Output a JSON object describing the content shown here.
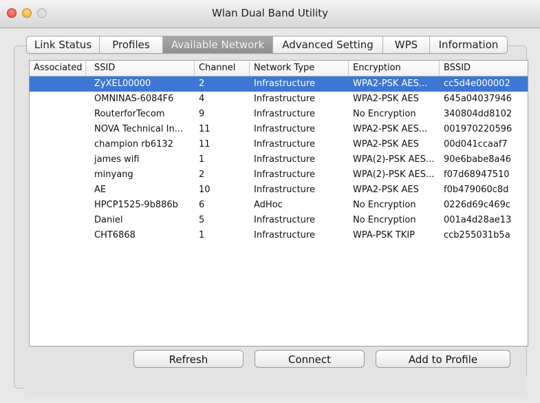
{
  "window": {
    "title": "Wlan Dual Band Utility"
  },
  "tabs": [
    {
      "label": "Link Status",
      "active": false
    },
    {
      "label": "Profiles",
      "active": false
    },
    {
      "label": "Available Network",
      "active": true
    },
    {
      "label": "Advanced Setting",
      "active": false
    },
    {
      "label": "WPS",
      "active": false
    },
    {
      "label": "Information",
      "active": false
    }
  ],
  "table": {
    "columns": [
      "Associated",
      "SSID",
      "Channel",
      "Network Type",
      "Encryption",
      "BSSID"
    ],
    "rows": [
      {
        "associated": "",
        "ssid": "ZyXEL00000",
        "channel": "2",
        "type": "Infrastructure",
        "encryption": "WPA2-PSK AES...",
        "bssid": "cc5d4e000002",
        "selected": true
      },
      {
        "associated": "",
        "ssid": "OMNINAS-6084F6",
        "channel": "4",
        "type": "Infrastructure",
        "encryption": "WPA2-PSK AES",
        "bssid": "645a04037946",
        "selected": false
      },
      {
        "associated": "",
        "ssid": "RouterforTecom",
        "channel": "9",
        "type": "Infrastructure",
        "encryption": "No Encryption",
        "bssid": "340804dd8102",
        "selected": false
      },
      {
        "associated": "",
        "ssid": "NOVA Technical In...",
        "channel": "11",
        "type": "Infrastructure",
        "encryption": "WPA2-PSK AES...",
        "bssid": "001970220596",
        "selected": false
      },
      {
        "associated": "",
        "ssid": "champion rb6132",
        "channel": "11",
        "type": "Infrastructure",
        "encryption": "WPA2-PSK AES",
        "bssid": "00d041ccaaf7",
        "selected": false
      },
      {
        "associated": "",
        "ssid": "james wifi",
        "channel": "1",
        "type": "Infrastructure",
        "encryption": "WPA(2)-PSK AES...",
        "bssid": "90e6babe8a46",
        "selected": false
      },
      {
        "associated": "",
        "ssid": "minyang",
        "channel": "2",
        "type": "Infrastructure",
        "encryption": "WPA(2)-PSK AES...",
        "bssid": "f07d68947510",
        "selected": false
      },
      {
        "associated": "",
        "ssid": "AE",
        "channel": "10",
        "type": "Infrastructure",
        "encryption": "WPA2-PSK AES",
        "bssid": "f0b479060c8d",
        "selected": false
      },
      {
        "associated": "",
        "ssid": "HPCP1525-9b886b",
        "channel": "6",
        "type": "AdHoc",
        "encryption": "No Encryption",
        "bssid": "0226d69c469c",
        "selected": false
      },
      {
        "associated": "",
        "ssid": "Daniel",
        "channel": "5",
        "type": "Infrastructure",
        "encryption": "No Encryption",
        "bssid": "001a4d28ae13",
        "selected": false
      },
      {
        "associated": "",
        "ssid": "CHT6868",
        "channel": "1",
        "type": "Infrastructure",
        "encryption": "WPA-PSK TKIP",
        "bssid": "ccb255031b5a",
        "selected": false
      }
    ]
  },
  "buttons": {
    "refresh": "Refresh",
    "connect": "Connect",
    "add_to_profile": "Add to Profile"
  },
  "colors": {
    "selection": "#3e76d6",
    "active_tab": "#969696"
  }
}
